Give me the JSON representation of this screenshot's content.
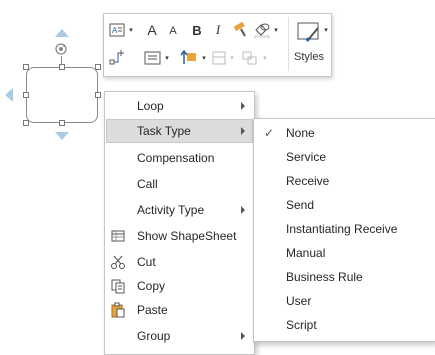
{
  "toolbar": {
    "font_grow": "A",
    "font_shrink": "A",
    "bold": "B",
    "italic": "I",
    "styles_label": "Styles"
  },
  "context_menu": {
    "items": [
      {
        "label": "Loop",
        "has_submenu": true
      },
      {
        "label": "Task Type",
        "has_submenu": true
      },
      {
        "label": "Compensation",
        "has_submenu": false
      },
      {
        "label": "Call",
        "has_submenu": false
      },
      {
        "label": "Activity Type",
        "has_submenu": true
      },
      {
        "label": "Show ShapeSheet",
        "has_submenu": false
      },
      {
        "label": "Cut",
        "has_submenu": false
      },
      {
        "label": "Copy",
        "has_submenu": false
      },
      {
        "label": "Paste",
        "has_submenu": false
      },
      {
        "label": "Group",
        "has_submenu": true
      }
    ],
    "highlighted": "Task Type"
  },
  "task_type_submenu": {
    "items": [
      "None",
      "Service",
      "Receive",
      "Send",
      "Instantiating Receive",
      "Manual",
      "Business Rule",
      "User",
      "Script"
    ],
    "checked": "None"
  },
  "colors": {
    "menu_highlight": "#dcdcdc",
    "arrow_blue": "#a9cbe6",
    "accent_orange": "#e8a33d"
  }
}
